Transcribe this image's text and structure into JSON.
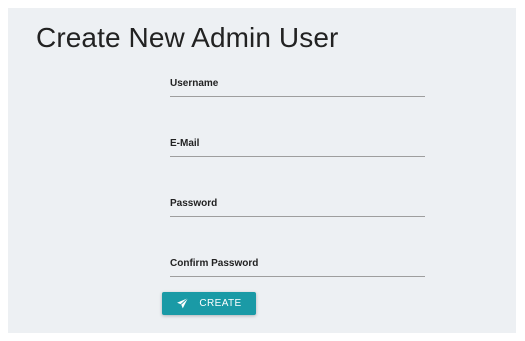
{
  "page": {
    "title": "Create New Admin User"
  },
  "form": {
    "fields": [
      {
        "label": "Username",
        "value": ""
      },
      {
        "label": "E-Mail",
        "value": ""
      },
      {
        "label": "Password",
        "value": ""
      },
      {
        "label": "Confirm Password",
        "value": ""
      }
    ],
    "submit": {
      "label": "CREATE",
      "icon": "send-icon"
    }
  },
  "colors": {
    "panel_background": "#edf0f3",
    "accent": "#1a9aa6",
    "underline": "#9e9e9e"
  }
}
